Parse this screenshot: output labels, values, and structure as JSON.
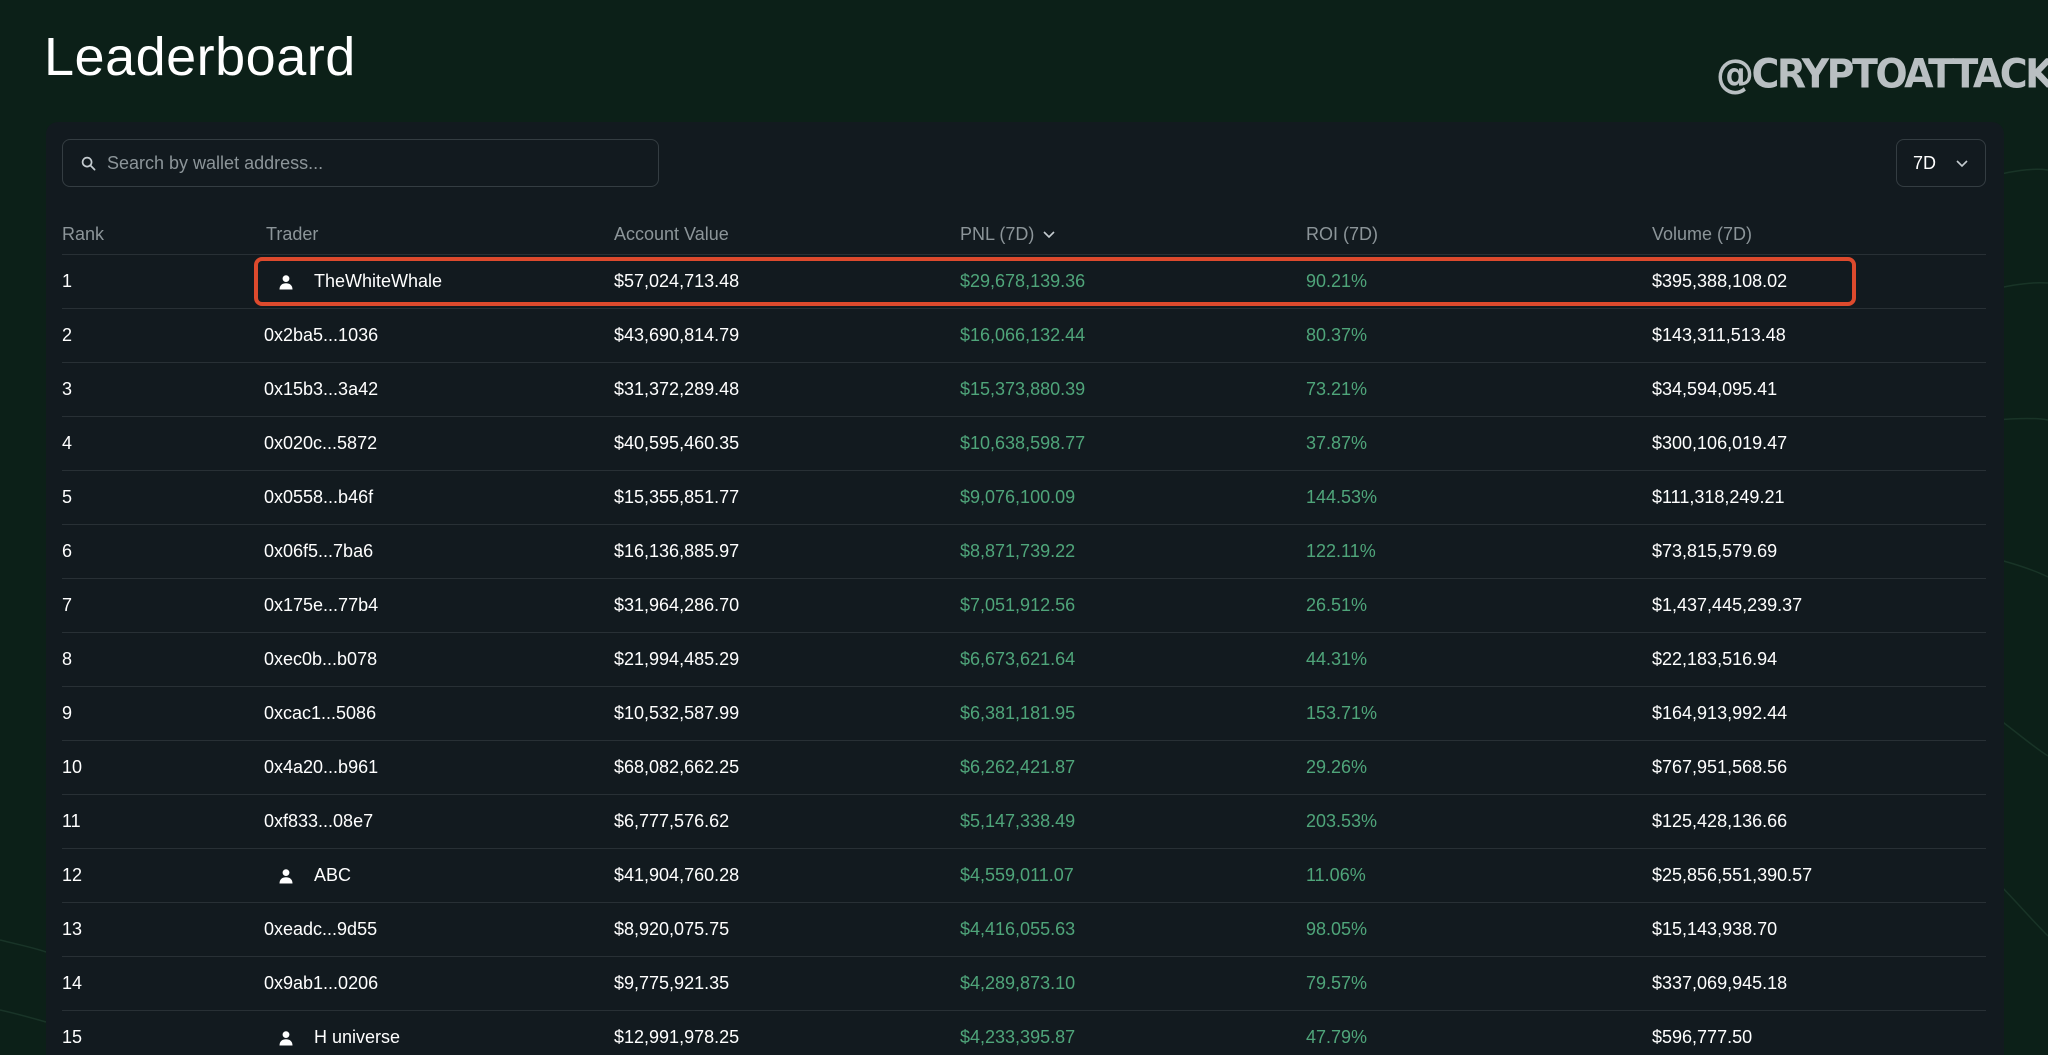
{
  "header": {
    "title": "Leaderboard",
    "watermark": "@CRYPTOATTACK"
  },
  "search": {
    "placeholder": "Search by wallet address..."
  },
  "period": {
    "selected": "7D"
  },
  "columns": {
    "rank": "Rank",
    "trader": "Trader",
    "account_value": "Account Value",
    "pnl": "PNL (7D)",
    "roi": "ROI (7D)",
    "volume": "Volume (7D)"
  },
  "rows": [
    {
      "rank": "1",
      "trader": "TheWhiteWhale",
      "named": true,
      "account_value": "$57,024,713.48",
      "pnl": "$29,678,139.36",
      "roi": "90.21%",
      "volume": "$395,388,108.02",
      "highlighted": true
    },
    {
      "rank": "2",
      "trader": "0x2ba5...1036",
      "named": false,
      "account_value": "$43,690,814.79",
      "pnl": "$16,066,132.44",
      "roi": "80.37%",
      "volume": "$143,311,513.48"
    },
    {
      "rank": "3",
      "trader": "0x15b3...3a42",
      "named": false,
      "account_value": "$31,372,289.48",
      "pnl": "$15,373,880.39",
      "roi": "73.21%",
      "volume": "$34,594,095.41"
    },
    {
      "rank": "4",
      "trader": "0x020c...5872",
      "named": false,
      "account_value": "$40,595,460.35",
      "pnl": "$10,638,598.77",
      "roi": "37.87%",
      "volume": "$300,106,019.47"
    },
    {
      "rank": "5",
      "trader": "0x0558...b46f",
      "named": false,
      "account_value": "$15,355,851.77",
      "pnl": "$9,076,100.09",
      "roi": "144.53%",
      "volume": "$111,318,249.21"
    },
    {
      "rank": "6",
      "trader": "0x06f5...7ba6",
      "named": false,
      "account_value": "$16,136,885.97",
      "pnl": "$8,871,739.22",
      "roi": "122.11%",
      "volume": "$73,815,579.69"
    },
    {
      "rank": "7",
      "trader": "0x175e...77b4",
      "named": false,
      "account_value": "$31,964,286.70",
      "pnl": "$7,051,912.56",
      "roi": "26.51%",
      "volume": "$1,437,445,239.37"
    },
    {
      "rank": "8",
      "trader": "0xec0b...b078",
      "named": false,
      "account_value": "$21,994,485.29",
      "pnl": "$6,673,621.64",
      "roi": "44.31%",
      "volume": "$22,183,516.94"
    },
    {
      "rank": "9",
      "trader": "0xcac1...5086",
      "named": false,
      "account_value": "$10,532,587.99",
      "pnl": "$6,381,181.95",
      "roi": "153.71%",
      "volume": "$164,913,992.44"
    },
    {
      "rank": "10",
      "trader": "0x4a20...b961",
      "named": false,
      "account_value": "$68,082,662.25",
      "pnl": "$6,262,421.87",
      "roi": "29.26%",
      "volume": "$767,951,568.56"
    },
    {
      "rank": "11",
      "trader": "0xf833...08e7",
      "named": false,
      "account_value": "$6,777,576.62",
      "pnl": "$5,147,338.49",
      "roi": "203.53%",
      "volume": "$125,428,136.66"
    },
    {
      "rank": "12",
      "trader": "ABC",
      "named": true,
      "account_value": "$41,904,760.28",
      "pnl": "$4,559,011.07",
      "roi": "11.06%",
      "volume": "$25,856,551,390.57"
    },
    {
      "rank": "13",
      "trader": "0xeadc...9d55",
      "named": false,
      "account_value": "$8,920,075.75",
      "pnl": "$4,416,055.63",
      "roi": "98.05%",
      "volume": "$15,143,938.70"
    },
    {
      "rank": "14",
      "trader": "0x9ab1...0206",
      "named": false,
      "account_value": "$9,775,921.35",
      "pnl": "$4,289,873.10",
      "roi": "79.57%",
      "volume": "$337,069,945.18"
    },
    {
      "rank": "15",
      "trader": "H universe",
      "named": true,
      "account_value": "$12,991,978.25",
      "pnl": "$4,233,395.87",
      "roi": "47.79%",
      "volume": "$596,777.50"
    }
  ],
  "icons": {
    "search": "search-icon",
    "user": "user-icon",
    "sort": "chevron-down-icon",
    "dropdown": "chevron-down-icon"
  },
  "colors": {
    "background": "#0c2018",
    "panel": "#121a1f",
    "positive": "#4fa57a",
    "highlight": "#dd4a2d"
  }
}
